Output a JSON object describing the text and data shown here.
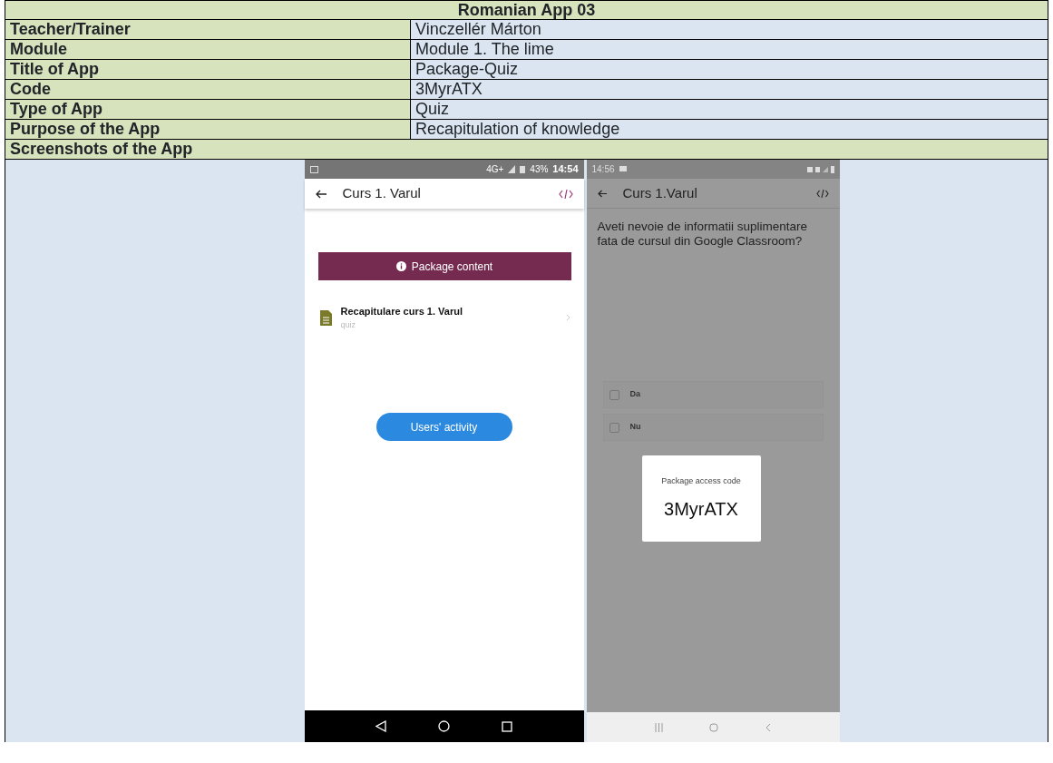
{
  "table": {
    "title": "Romanian App 03",
    "rows": [
      {
        "label": "Teacher/Trainer",
        "value": "Vinczellér Márton"
      },
      {
        "label": "Module",
        "value": "Module 1. The lime"
      },
      {
        "label": "Title of App",
        "value": "Package-Quiz"
      },
      {
        "label": "Code",
        "value": "3MyrATX"
      },
      {
        "label": "Type of App",
        "value": "Quiz"
      },
      {
        "label": "Purpose of the App",
        "value": "Recapitulation of knowledge"
      }
    ],
    "section": "Screenshots of the App"
  },
  "screenshot_1": {
    "network": "4G+",
    "battery": "43%",
    "time": "14:54",
    "title": "Curs 1. Varul",
    "banner": "Package content",
    "item_title": "Recapitulare curs 1. Varul",
    "item_type": "quiz",
    "button": "Users' activity"
  },
  "screenshot_2": {
    "time": "14:56",
    "title": "Curs 1.Varul",
    "question": "Aveti nevoie de informatii suplimentare fata de cursul din Google Classroom?",
    "options": [
      {
        "label": "Da",
        "checked": false
      },
      {
        "label": "Nu",
        "checked": false
      }
    ],
    "dialog": {
      "title": "Package access code",
      "code": "3MyrATX"
    }
  }
}
